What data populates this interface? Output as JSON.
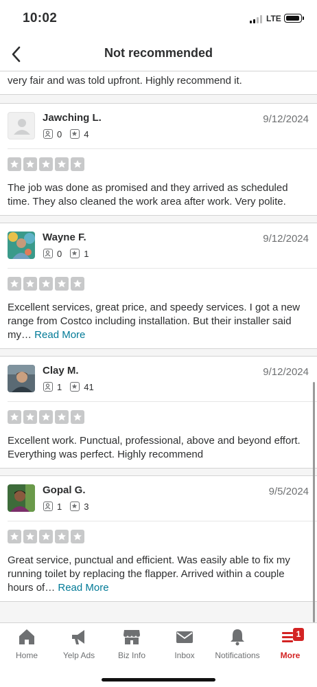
{
  "status": {
    "time": "10:02",
    "network": "LTE"
  },
  "nav": {
    "title": "Not recommended",
    "back_icon": "chevron-left-icon"
  },
  "partial_review": {
    "text": "very fair and was told upfront. Highly recommend it."
  },
  "reviews": [
    {
      "name": "Jawching L.",
      "friends": "0",
      "reviews": "4",
      "date": "9/12/2024",
      "rating": 5,
      "text": "The job was done as promised and they arrived as scheduled time. They also cleaned the work area after work. Very polite.",
      "read_more": ""
    },
    {
      "name": "Wayne F.",
      "friends": "0",
      "reviews": "1",
      "date": "9/12/2024",
      "rating": 5,
      "text": "Excellent services, great price, and speedy services. I got a new range from Costco including installation. But their installer said my…",
      "read_more": "Read More"
    },
    {
      "name": "Clay M.",
      "friends": "1",
      "reviews": "41",
      "date": "9/12/2024",
      "rating": 5,
      "text": "Excellent work. Punctual, professional, above and beyond effort. Everything was perfect. Highly recommend",
      "read_more": ""
    },
    {
      "name": "Gopal G.",
      "friends": "1",
      "reviews": "3",
      "date": "9/5/2024",
      "rating": 5,
      "text": "Great service, punctual and efficient. Was easily able to fix my running toilet by replacing the flapper. Arrived within a couple hours of…",
      "read_more": "Read More"
    }
  ],
  "tabs": [
    {
      "label": "Home",
      "icon": "home-icon"
    },
    {
      "label": "Yelp Ads",
      "icon": "megaphone-icon"
    },
    {
      "label": "Biz Info",
      "icon": "storefront-icon"
    },
    {
      "label": "Inbox",
      "icon": "envelope-icon"
    },
    {
      "label": "Notifications",
      "icon": "bell-icon"
    },
    {
      "label": "More",
      "icon": "menu-icon",
      "badge": "1",
      "active": true
    }
  ],
  "colors": {
    "accent": "#d32323",
    "link": "#027a97",
    "star_empty": "#c8c9ca"
  }
}
